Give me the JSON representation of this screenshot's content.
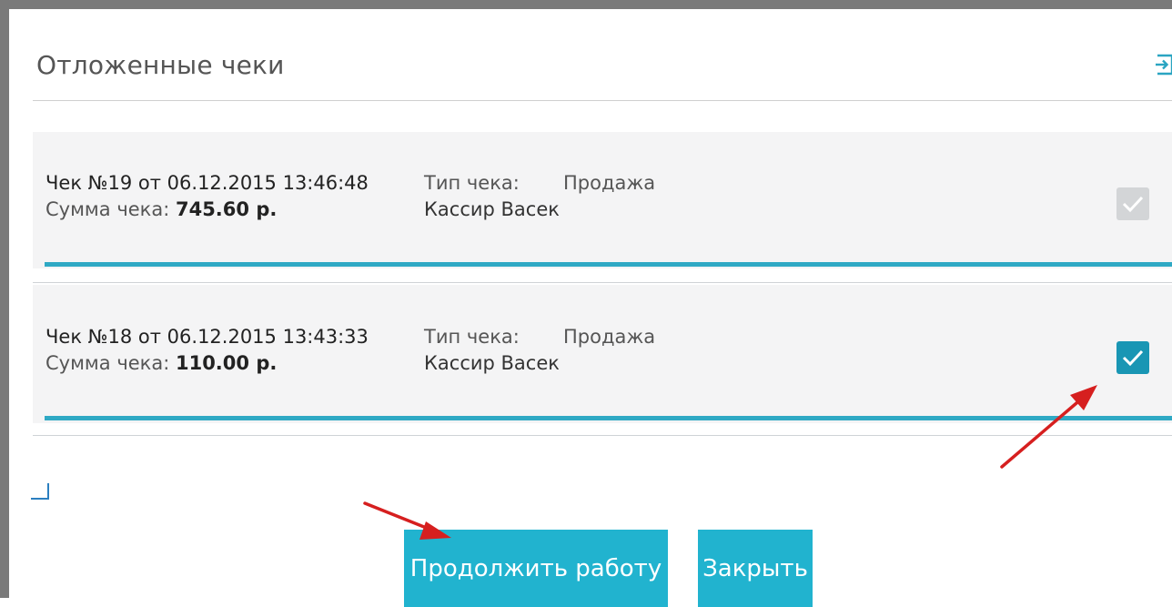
{
  "dialog": {
    "title": "Отложенные чеки",
    "exit_icon": "sign-out-icon"
  },
  "receipts": [
    {
      "title": "Чек №19 от 06.12.2015 13:46:48",
      "sum_label": "Сумма чека:",
      "sum_value": "745.60 р.",
      "type_label": "Тип чека:",
      "type_value": "Продажа",
      "cashier": "Кассир Васек",
      "checked": false
    },
    {
      "title": "Чек №18 от 06.12.2015 13:43:33",
      "sum_label": "Сумма чека:",
      "sum_value": "110.00 р.",
      "type_label": "Тип чека:",
      "type_value": "Продажа",
      "cashier": "Кассир Васек",
      "checked": true
    }
  ],
  "buttons": {
    "continue_label": "Продолжить работу",
    "close_label": "Закрыть"
  },
  "colors": {
    "accent": "#2fa9c4",
    "button": "#21b3cf",
    "checkbox_on": "#1996b4",
    "arrow": "#d61f1f"
  }
}
